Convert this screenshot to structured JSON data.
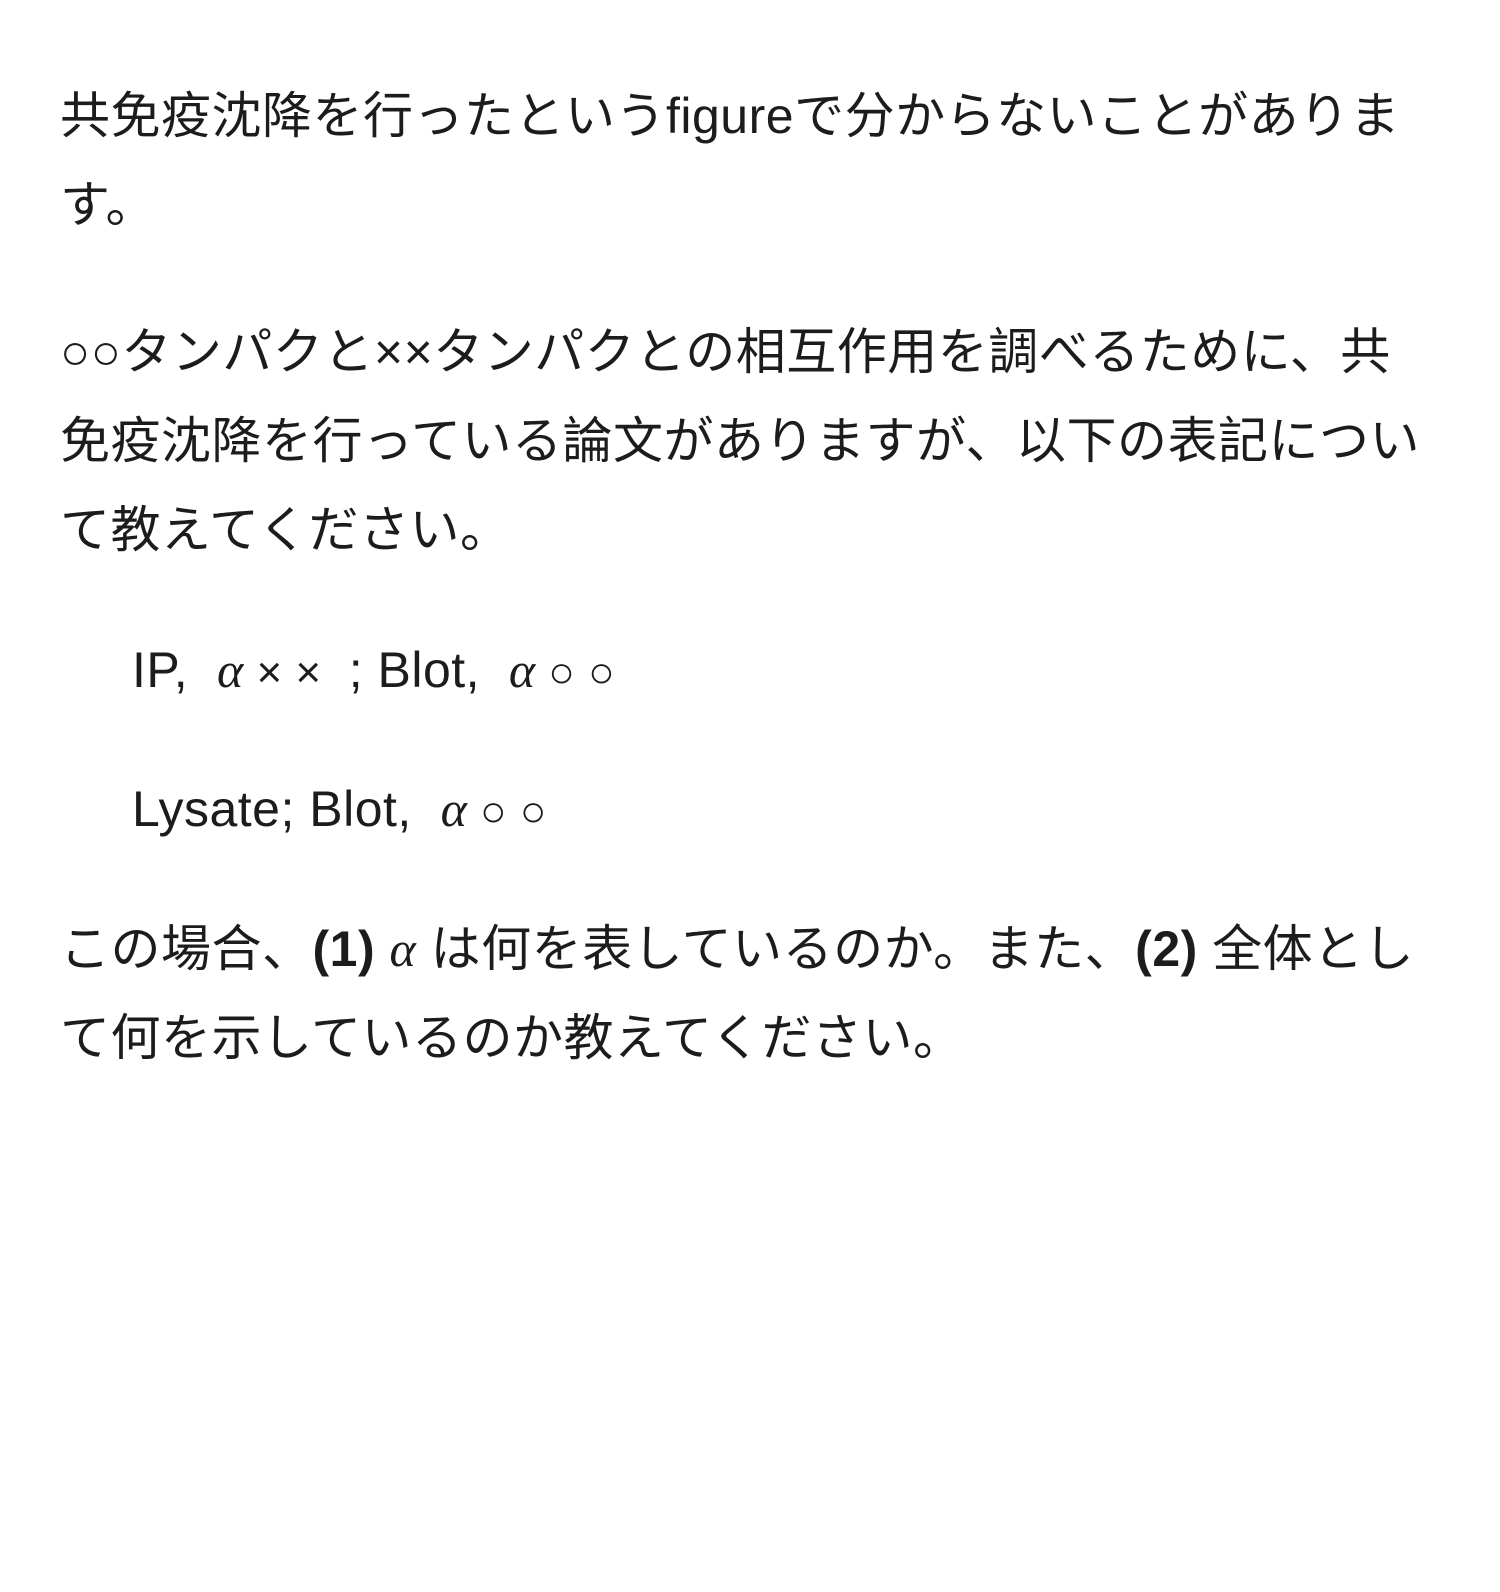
{
  "para1": "共免疫沈降を行ったというfigureで分からないことがあります。",
  "para2": "○○タンパクと××タンパクとの相互作用を調べるために、共免疫沈降を行っている論文がありますが、以下の表記について教えてください。",
  "formula1": {
    "prefix": "IP,  ",
    "alpha": "α",
    "symbols1": " × × ",
    "mid": " ; Blot,  ",
    "symbols2": " ○ ○"
  },
  "formula2": {
    "prefix": "Lysate; Blot,  ",
    "alpha": "α",
    "symbols": " ○ ○"
  },
  "para3": {
    "t1": "この場合、",
    "q1": "(1)",
    "space1": " ",
    "alpha": "α",
    "t2": " は何を表しているのか。また、",
    "q2": "(2)",
    "t3": " 全体として何を示しているのか教えてください。"
  }
}
